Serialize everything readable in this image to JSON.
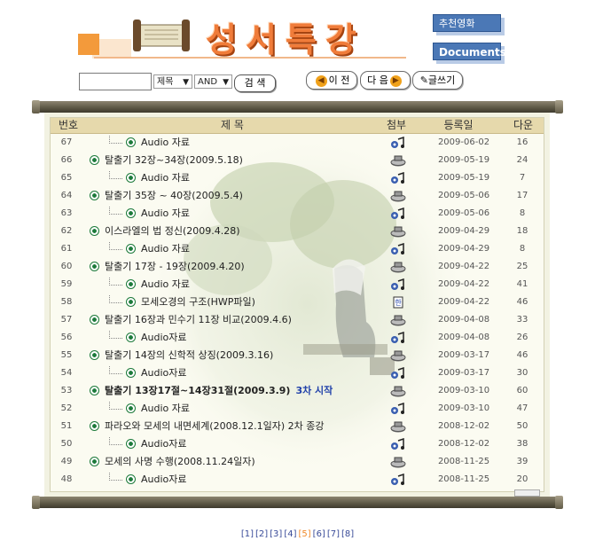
{
  "header": {
    "title": "성서특강",
    "recommend_button": "추천영화",
    "documents_button": "Documents"
  },
  "search": {
    "field_value": "",
    "select_field": "제목",
    "select_logic": "AND",
    "search_button": "검 색"
  },
  "nav": {
    "prev": "이 전",
    "next": "다 음",
    "write": "글쓰기"
  },
  "table": {
    "headers": {
      "num": "번호",
      "title": "제 목",
      "attach": "첨부",
      "date": "등록일",
      "views": "다운"
    },
    "rows": [
      {
        "num": "67",
        "title": "Audio 자료",
        "type": "sub",
        "attach": "audio-file-icon",
        "date": "2009-06-02",
        "views": "16"
      },
      {
        "num": "66",
        "title": "탈출기 32장~34장(2009.5.18)",
        "type": "main",
        "attach": "video-file-icon",
        "date": "2009-05-19",
        "views": "24"
      },
      {
        "num": "65",
        "title": "Audio 자료",
        "type": "sub",
        "attach": "audio-file-icon",
        "date": "2009-05-19",
        "views": "7"
      },
      {
        "num": "64",
        "title": "탈출기 35장 ~ 40장(2009.5.4)",
        "type": "main",
        "attach": "video-file-icon",
        "date": "2009-05-06",
        "views": "17"
      },
      {
        "num": "63",
        "title": "Audio 자료",
        "type": "sub",
        "attach": "audio-file-icon",
        "date": "2009-05-06",
        "views": "8"
      },
      {
        "num": "62",
        "title": "이스라엘의 법 정신(2009.4.28)",
        "type": "main",
        "attach": "video-file-icon",
        "date": "2009-04-29",
        "views": "18"
      },
      {
        "num": "61",
        "title": "Audio 자료",
        "type": "sub",
        "attach": "audio-file-icon",
        "date": "2009-04-29",
        "views": "8"
      },
      {
        "num": "60",
        "title": "탈출기 17장 - 19장(2009.4.20)",
        "type": "main",
        "attach": "video-file-icon",
        "date": "2009-04-22",
        "views": "25"
      },
      {
        "num": "59",
        "title": "Audio 자료",
        "type": "sub",
        "attach": "audio-file-icon",
        "date": "2009-04-22",
        "views": "41"
      },
      {
        "num": "58",
        "title": "모세오경의 구조(HWP파일)",
        "type": "sub",
        "attach": "hwp-file-icon",
        "date": "2009-04-22",
        "views": "46"
      },
      {
        "num": "57",
        "title": "탈출기 16장과 민수기 11장 비교(2009.4.6)",
        "type": "main",
        "attach": "video-file-icon",
        "date": "2009-04-08",
        "views": "33"
      },
      {
        "num": "56",
        "title": "Audio자료",
        "type": "sub",
        "attach": "audio-file-icon",
        "date": "2009-04-08",
        "views": "26"
      },
      {
        "num": "55",
        "title": "탈출기 14장의 신학적 상징(2009.3.16)",
        "type": "main",
        "attach": "video-file-icon",
        "date": "2009-03-17",
        "views": "46"
      },
      {
        "num": "54",
        "title": "Audio자료",
        "type": "sub",
        "attach": "audio-file-icon",
        "date": "2009-03-17",
        "views": "30"
      },
      {
        "num": "53",
        "title": "탈출기 13장17절~14장31절(2009.3.9)",
        "extra": "3차 시작",
        "type": "main",
        "bold": true,
        "attach": "video-file-icon",
        "date": "2009-03-10",
        "views": "60"
      },
      {
        "num": "52",
        "title": "Audio 자료",
        "type": "sub",
        "attach": "audio-file-icon",
        "date": "2009-03-10",
        "views": "47"
      },
      {
        "num": "51",
        "title": "파라오와 모세의 내면세계(2008.12.1일자) 2차 종강",
        "type": "main",
        "attach": "video-file-icon",
        "date": "2008-12-02",
        "views": "50"
      },
      {
        "num": "50",
        "title": "Audio자료",
        "type": "sub",
        "attach": "audio-file-icon",
        "date": "2008-12-02",
        "views": "38"
      },
      {
        "num": "49",
        "title": "모세의 사명 수행(2008.11.24일자)",
        "type": "main",
        "attach": "video-file-icon",
        "date": "2008-11-25",
        "views": "39"
      },
      {
        "num": "48",
        "title": "Audio자료",
        "type": "sub",
        "attach": "audio-file-icon",
        "date": "2008-11-25",
        "views": "20"
      }
    ]
  },
  "pagination": {
    "pages": [
      "[1]",
      "[2]",
      "[3]",
      "[4]",
      "[5]",
      "[6]",
      "[7]",
      "[8]"
    ],
    "current_index": 4
  },
  "colors": {
    "accent_orange": "#f07c3a",
    "button_blue": "#4b78b6",
    "bullet_green": "#1c7a3a",
    "header_tan": "#e6d9ac"
  }
}
